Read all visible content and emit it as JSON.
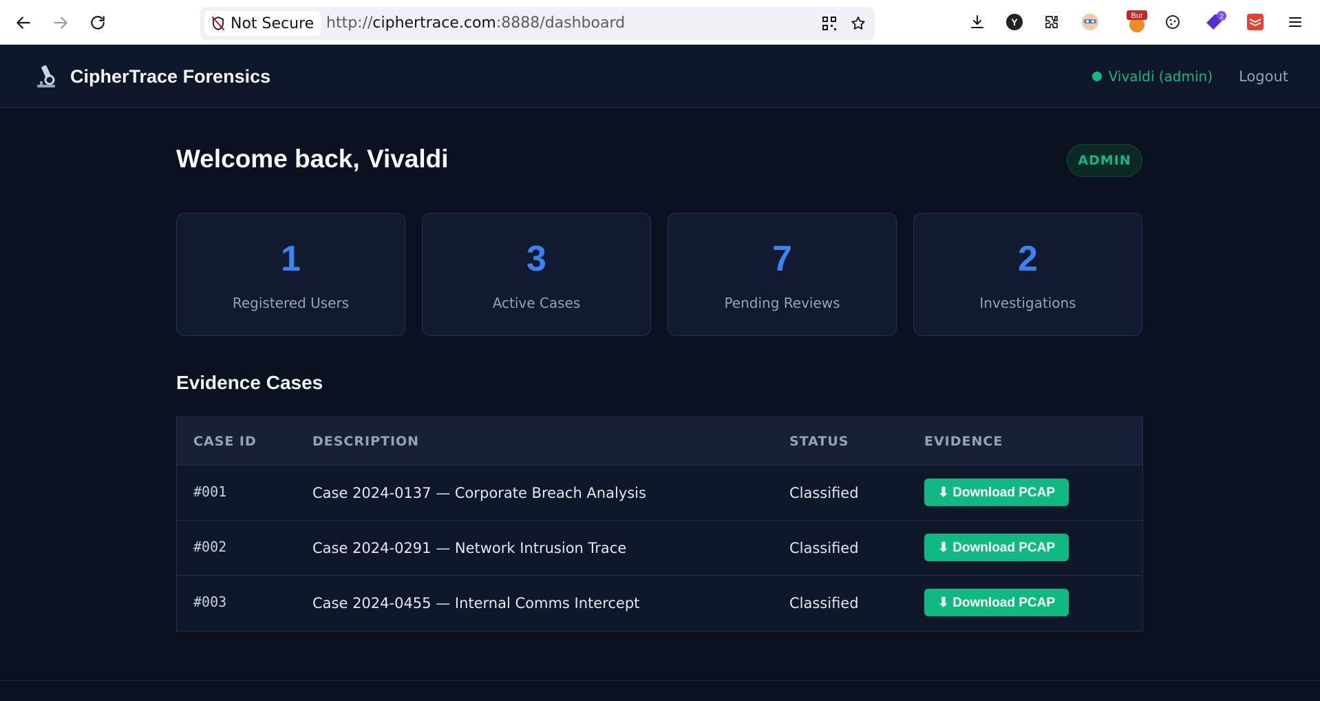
{
  "browser": {
    "security_label": "Not Secure",
    "url_prefix": "http://",
    "url_host": "ciphertrace.com",
    "url_rest": ":8888/dashboard",
    "extension_badges": {
      "burp": "Bur",
      "notifications": "2"
    }
  },
  "app": {
    "brand_title": "CipherTrace Forensics",
    "user_status": "Vivaldi (admin)",
    "logout_label": "Logout"
  },
  "main": {
    "welcome": "Welcome back, Vivaldi",
    "role_badge": "ADMIN",
    "stats": [
      {
        "value": "1",
        "label": "Registered Users"
      },
      {
        "value": "3",
        "label": "Active Cases"
      },
      {
        "value": "7",
        "label": "Pending Reviews"
      },
      {
        "value": "2",
        "label": "Investigations"
      }
    ],
    "section_title": "Evidence Cases",
    "table": {
      "headers": [
        "CASE ID",
        "DESCRIPTION",
        "STATUS",
        "EVIDENCE"
      ],
      "rows": [
        {
          "id": "#001",
          "description": "Case 2024-0137 — Corporate Breach Analysis",
          "status": "Classified",
          "action": "⬇ Download PCAP"
        },
        {
          "id": "#002",
          "description": "Case 2024-0291 — Network Intrusion Trace",
          "status": "Classified",
          "action": "⬇ Download PCAP"
        },
        {
          "id": "#003",
          "description": "Case 2024-0455 — Internal Comms Intercept",
          "status": "Classified",
          "action": "⬇ Download PCAP"
        }
      ]
    }
  },
  "colors": {
    "accent_blue": "#3b82f6",
    "accent_green": "#10b981",
    "background": "#0b1120"
  },
  "icons": {
    "back": "arrow-left-icon",
    "forward": "arrow-right-icon",
    "reload": "reload-icon",
    "security": "shield-off-icon",
    "brand": "microscope-icon"
  }
}
